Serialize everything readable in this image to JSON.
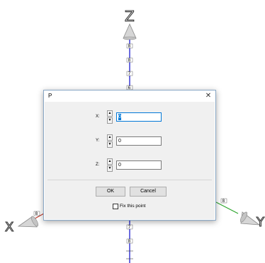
{
  "scene": {
    "axes": {
      "z_label": "Z",
      "x_label": "X",
      "y_label": "Y",
      "colors": {
        "z": "#2b2bcf",
        "x": "#c0392b",
        "y": "#2ea52e",
        "cone": "#d6d6d6",
        "cone_edge": "#8a8a8a"
      }
    },
    "ticks_top": [
      "8",
      "8",
      "7",
      "6"
    ],
    "ticks_bottom": [
      "7",
      "8"
    ],
    "tick_x": "8",
    "tick_y": "8"
  },
  "dialog": {
    "title": "P",
    "close_symbol": "✕",
    "fields": [
      {
        "label": "X:",
        "value": "0",
        "selected": true
      },
      {
        "label": "Y:",
        "value": "0",
        "selected": false
      },
      {
        "label": "Z:",
        "value": "0",
        "selected": false
      }
    ],
    "spin_up": "▲",
    "spin_down": "▼",
    "ok_label": "OK",
    "cancel_label": "Cancel",
    "fix_point_label": "Fix this point",
    "fix_point_checked": false
  }
}
